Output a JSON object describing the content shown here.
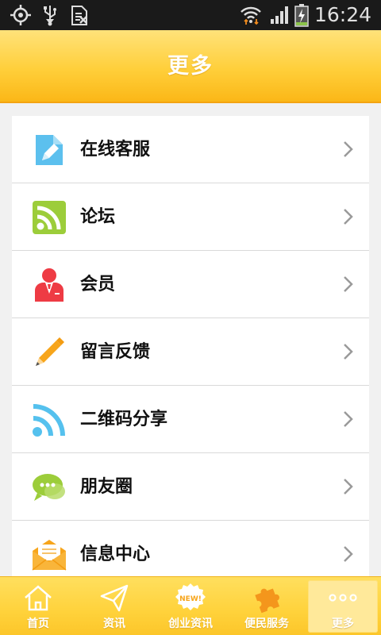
{
  "status_bar": {
    "time": "16:24",
    "icons": [
      "gps-icon",
      "usb-icon",
      "sim-icon",
      "wifi-icon",
      "signal-icon",
      "battery-charging-icon"
    ]
  },
  "header": {
    "title": "更多"
  },
  "menu": {
    "items": [
      {
        "label": "在线客服",
        "icon": "document-pen-icon",
        "color": "#5cc0ee"
      },
      {
        "label": "论坛",
        "icon": "rss-box-icon",
        "color": "#9ccd3a"
      },
      {
        "label": "会员",
        "icon": "member-icon",
        "color": "#ee3b44"
      },
      {
        "label": "留言反馈",
        "icon": "pencil-icon",
        "color": "#f7a51b"
      },
      {
        "label": "二维码分享",
        "icon": "wifi-share-icon",
        "color": "#55c1ee"
      },
      {
        "label": "朋友圈",
        "icon": "chat-bubble-icon",
        "color": "#9ccd3a"
      },
      {
        "label": "信息中心",
        "icon": "envelope-icon",
        "color": "#f7a51b"
      }
    ]
  },
  "tabs": {
    "items": [
      {
        "label": "首页",
        "icon": "home-icon"
      },
      {
        "label": "资讯",
        "icon": "paper-plane-icon"
      },
      {
        "label": "创业资讯",
        "icon": "new-badge-icon",
        "badge": "NEW!"
      },
      {
        "label": "便民服务",
        "icon": "puzzle-icon"
      },
      {
        "label": "更多",
        "icon": "more-dots-icon"
      }
    ],
    "active": "更多"
  },
  "colors": {
    "header_yellow": "#ffcf3a",
    "tab_yellow": "#ffd23b",
    "list_bg": "#ffffff",
    "page_bg": "#f1f1f1"
  }
}
